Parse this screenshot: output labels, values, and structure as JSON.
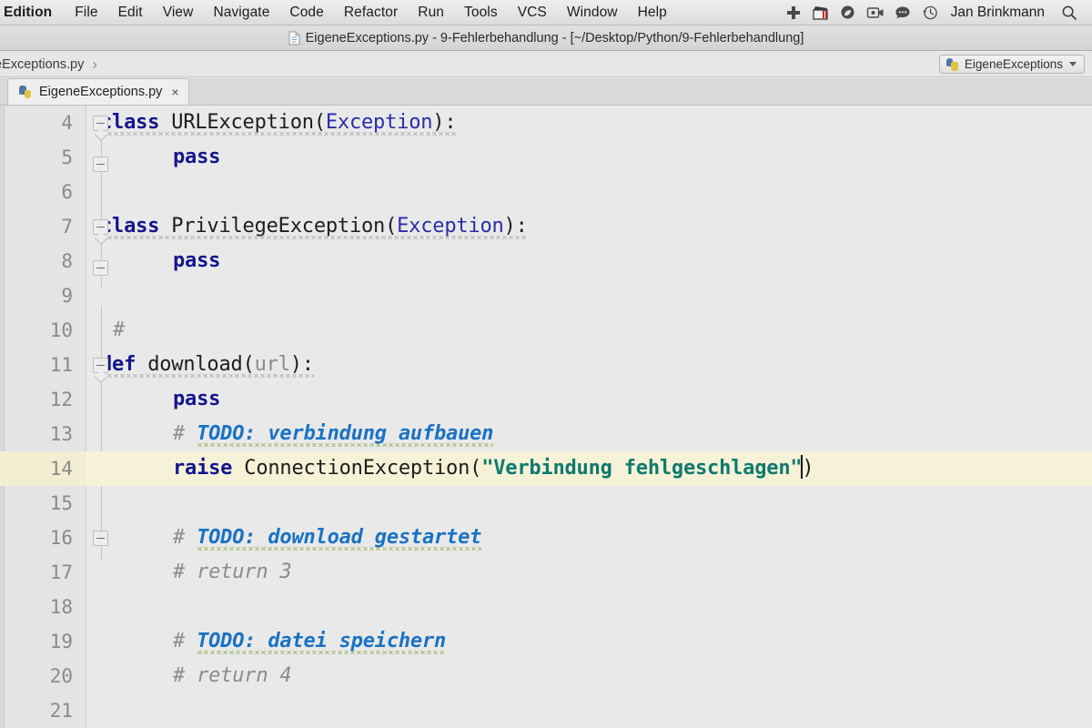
{
  "menubar": {
    "app_name": "Edition",
    "items": [
      "File",
      "Edit",
      "View",
      "Navigate",
      "Code",
      "Refactor",
      "Run",
      "Tools",
      "VCS",
      "Window",
      "Help"
    ],
    "tray_icons": [
      "medical-cross-icon",
      "clapperboard-icon",
      "leaf-icon",
      "video-camera-icon",
      "speech-bubble-icon",
      "time-machine-icon"
    ],
    "user_name": "Jan Brinkmann",
    "search_icon": "search-icon"
  },
  "titlebar": {
    "file_icon": "python-file-icon",
    "title": "EigeneExceptions.py - 9-Fehlerbehandlung - [~/Desktop/Python/9-Fehlerbehandlung]"
  },
  "breadcrumb": {
    "crumb": "eExceptions.py",
    "separator": "›"
  },
  "run_config": {
    "icon": "python-config-icon",
    "label": "EigeneExceptions",
    "caret": "chevron-down-icon"
  },
  "tabs": [
    {
      "icon": "python-file-icon",
      "label": "EigeneExceptions.py",
      "close": "×",
      "active": true
    }
  ],
  "editor": {
    "colors": {
      "background": "#e9e9e9",
      "gutter": "#e4e4e4",
      "current_line": "#f6f2d8",
      "keyword": "#15158c",
      "base_class": "#2b2ba8",
      "string": "#0e7a6e",
      "comment": "#8c8c8c",
      "todo": "#1a72c4",
      "parameter": "#8b8b8b"
    },
    "first_line": 4,
    "current_line": 14,
    "lines": [
      {
        "n": "4",
        "indent": 0,
        "fold": "start",
        "text": "class URLException(Exception):"
      },
      {
        "n": "5",
        "indent": 1,
        "fold": "end",
        "text": "pass"
      },
      {
        "n": "6",
        "indent": 0,
        "fold": "",
        "text": ""
      },
      {
        "n": "7",
        "indent": 0,
        "fold": "start",
        "text": "class PrivilegeException(Exception):"
      },
      {
        "n": "8",
        "indent": 1,
        "fold": "end",
        "text": "pass"
      },
      {
        "n": "9",
        "indent": 0,
        "fold": "",
        "text": ""
      },
      {
        "n": "10",
        "indent": 0,
        "fold": "",
        "text": "#"
      },
      {
        "n": "11",
        "indent": 0,
        "fold": "start",
        "text": "def download(url):"
      },
      {
        "n": "12",
        "indent": 1,
        "fold": "",
        "text": "pass"
      },
      {
        "n": "13",
        "indent": 1,
        "fold": "",
        "text": "# TODO: verbindung aufbauen"
      },
      {
        "n": "14",
        "indent": 1,
        "fold": "",
        "text": "raise ConnectionException(\"Verbindung fehlgeschlagen\")"
      },
      {
        "n": "15",
        "indent": 0,
        "fold": "",
        "text": ""
      },
      {
        "n": "16",
        "indent": 1,
        "fold": "end",
        "text": "# TODO: download gestartet"
      },
      {
        "n": "17",
        "indent": 1,
        "fold": "",
        "text": "# return 3"
      },
      {
        "n": "18",
        "indent": 0,
        "fold": "",
        "text": ""
      },
      {
        "n": "19",
        "indent": 1,
        "fold": "",
        "text": "# TODO: datei speichern"
      },
      {
        "n": "20",
        "indent": 1,
        "fold": "",
        "text": "# return 4"
      },
      {
        "n": "21",
        "indent": 0,
        "fold": "",
        "text": ""
      }
    ],
    "tokens": {
      "kw_class": "class",
      "kw_def": "def",
      "kw_pass": "pass",
      "kw_raise": "raise",
      "name_urlexception": "URLException",
      "name_privilegeexception": "PrivilegeException",
      "name_exception": "Exception",
      "name_download": "download",
      "name_url": "url",
      "name_connectionexception": "ConnectionException",
      "string_verbindung": "\"Verbindung fehlgeschlagen\"",
      "comment_hash": "#",
      "comment_return3": "# return 3",
      "comment_return4": "# return 4",
      "todo_hash": "# ",
      "todo_verbindung": "TODO: verbindung aufbauen",
      "todo_download": "TODO: download gestartet",
      "todo_datei": "TODO: datei speichern",
      "paren_open": "(",
      "paren_close": ")",
      "colon": ":"
    }
  }
}
